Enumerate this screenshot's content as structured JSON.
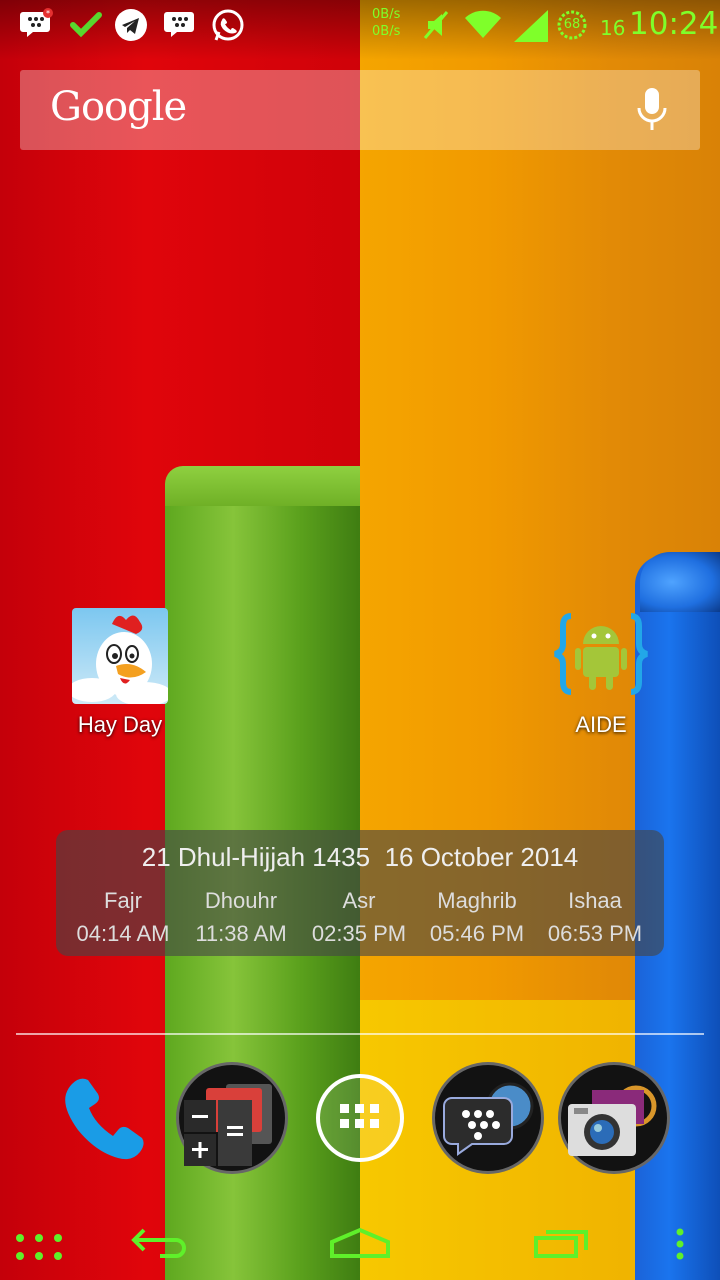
{
  "status_bar": {
    "net_up": "0B/s",
    "net_down": "0B/s",
    "battery": "68",
    "date": "16",
    "time": "10:24",
    "accent_color": "#7fff2a"
  },
  "search": {
    "logo": "Google"
  },
  "apps": [
    {
      "label": "Hay Day",
      "icon": "hay-day-icon"
    },
    {
      "label": "AIDE",
      "icon": "aide-android-icon"
    }
  ],
  "prayer_widget": {
    "hijri_date": "21 Dhul-Hijjah 1435",
    "gregorian_date": "16 October 2014",
    "times": [
      {
        "name": "Fajr",
        "time": "04:14 AM"
      },
      {
        "name": "Dhouhr",
        "time": "11:38 AM"
      },
      {
        "name": "Asr",
        "time": "02:35 PM"
      },
      {
        "name": "Maghrib",
        "time": "05:46 PM"
      },
      {
        "name": "Ishaa",
        "time": "06:53 PM"
      }
    ]
  },
  "dock": [
    {
      "icon": "phone-icon"
    },
    {
      "icon": "calculator-icon"
    },
    {
      "icon": "app-drawer-icon"
    },
    {
      "icon": "bbm-icon"
    },
    {
      "icon": "camera-icon"
    }
  ],
  "navbar": {
    "icons": [
      "menu-dots-icon",
      "back-icon",
      "home-icon",
      "recents-icon",
      "overflow-icon"
    ]
  }
}
